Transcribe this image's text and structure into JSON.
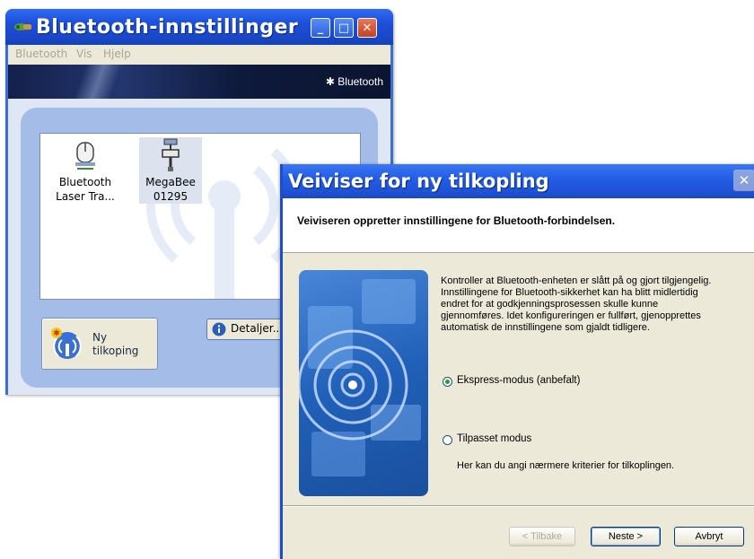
{
  "settings_window": {
    "title": "Bluetooth-innstillinger",
    "caption_buttons": {
      "minimize": "_",
      "maximize": "□",
      "close": "✕"
    },
    "menu": [
      "Bluetooth",
      "Vis",
      "Hjelp"
    ],
    "banner_logo": "Bluetooth",
    "devices": [
      {
        "line1": "Bluetooth",
        "line2": "Laser Tra...",
        "icon": "mouse-icon",
        "selected": false
      },
      {
        "line1": "MegaBee",
        "line2": "01295",
        "icon": "usb-adapter-icon",
        "selected": true
      }
    ],
    "new_connection_button": {
      "line1": "Ny",
      "line2": "tilkoping"
    },
    "details_button": "Detaljer..."
  },
  "wizard_window": {
    "title": "Veiviser for ny tilkopling",
    "header_text": "Veiviseren oppretter innstillingene for Bluetooth-forbindelsen.",
    "description": [
      "Kontroller at Bluetooth-enheten er slått på og gjort tilgjengelig.",
      "Innstillingene for Bluetooth-sikkerhet kan ha blitt midlertidig",
      "endret for at godkjenningsprosessen skulle kunne",
      "gjennomføres. Idet konfigureringen er fullført, gjenopprettes",
      "automatisk de innstillingene som gjaldt tidligere."
    ],
    "option_express": "Ekspress-modus (anbefalt)",
    "option_custom": "Tilpasset modus",
    "option_custom_desc": "Her kan du angi nærmere kriterier for tilkoplingen.",
    "selected_option": "express",
    "back_button": "< Tilbake",
    "next_button": "Neste >",
    "cancel_button": "Avbryt"
  },
  "colors": {
    "xp_title_blue": "#245ee6",
    "dialog_bg": "#ece9d8",
    "panel_blue": "#a4bde8",
    "radio_green": "#21a121"
  }
}
